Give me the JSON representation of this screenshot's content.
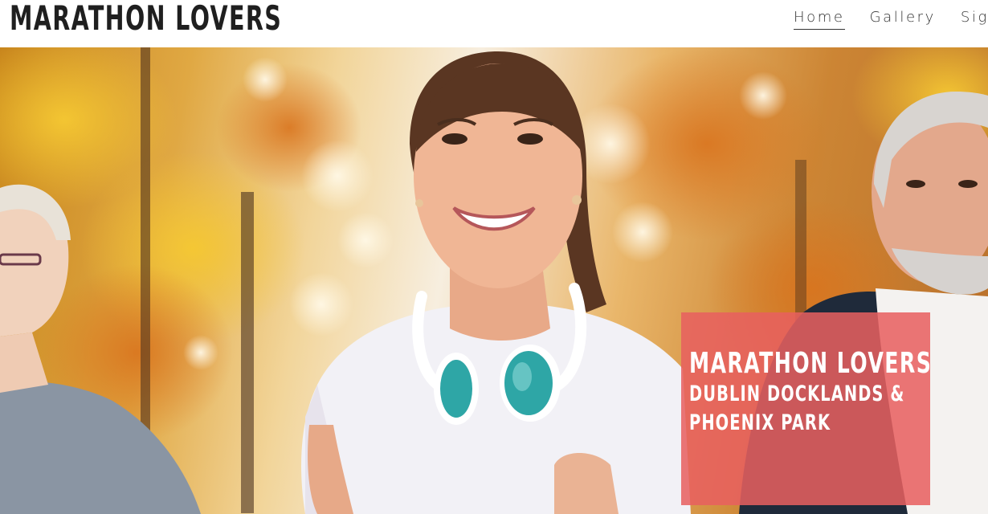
{
  "header": {
    "site_title": "MARATHON LOVERS",
    "nav": [
      {
        "label": "Home",
        "active": true
      },
      {
        "label": "Gallery",
        "active": false
      },
      {
        "label": "Sign",
        "active": false
      }
    ]
  },
  "hero": {
    "image_description_icon": "runners-photo",
    "card": {
      "line1": "MARATHON LOVERS",
      "line2": "DUBLIN DOCKLANDS &",
      "line3": "PHOENIX PARK"
    },
    "colors": {
      "card_background": "#e86060",
      "foliage_orange": "#d98a2a",
      "foliage_yellow": "#f0c44a"
    }
  }
}
